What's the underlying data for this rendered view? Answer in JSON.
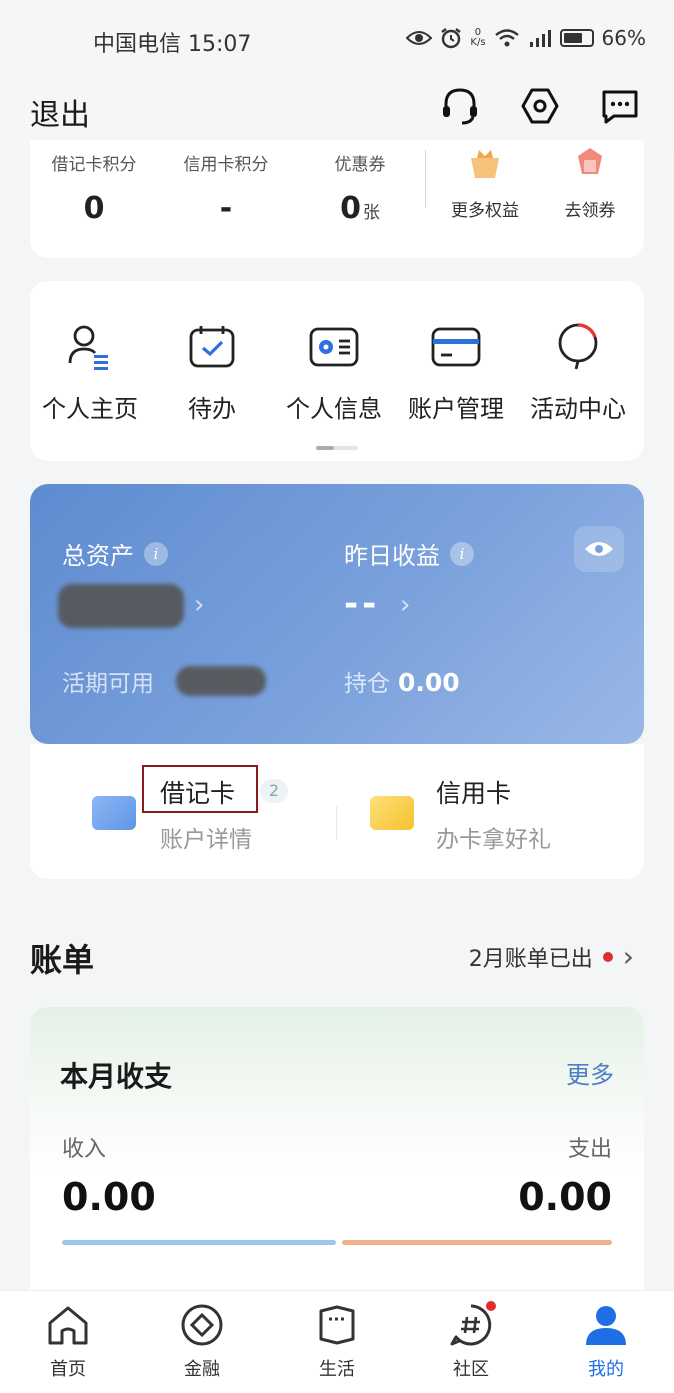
{
  "status_bar": {
    "carrier_time": "中国电信 15:07",
    "net_speed": "0",
    "net_unit": "K/s",
    "battery": "66%",
    "icons": [
      "eye-icon",
      "alarm-icon",
      "wifi-icon",
      "signal-icon",
      "battery-icon"
    ]
  },
  "header": {
    "exit_label": "退出",
    "icons": [
      "headset-icon",
      "settings-icon",
      "message-icon"
    ]
  },
  "points": {
    "debit_points_label": "借记卡积分",
    "debit_points_value": "0",
    "credit_points_label": "信用卡积分",
    "credit_points_value": "-",
    "coupon_label": "优惠券",
    "coupon_value": "0",
    "coupon_unit": "张",
    "more_benefits": "更多权益",
    "get_coupons": "去领券"
  },
  "quick_menu": {
    "items": [
      {
        "label": "个人主页",
        "icon": "profile-icon"
      },
      {
        "label": "待办",
        "icon": "calendar-icon"
      },
      {
        "label": "个人信息",
        "icon": "id-card-icon"
      },
      {
        "label": "账户管理",
        "icon": "bank-card-icon"
      },
      {
        "label": "活动中心",
        "icon": "balloon-icon"
      }
    ]
  },
  "assets": {
    "total_label": "总资产",
    "yesterday_label": "昨日收益",
    "yesterday_value": "--",
    "available_label": "活期可用",
    "holding_label": "持仓",
    "holding_value": "0.00"
  },
  "cards": {
    "debit_title": "借记卡",
    "debit_count": "2",
    "debit_sub": "账户详情",
    "credit_title": "信用卡",
    "credit_sub": "办卡拿好礼"
  },
  "bill": {
    "title": "账单",
    "status": "2月账单已出",
    "monthly_title": "本月收支",
    "more": "更多",
    "income_label": "收入",
    "income_value": "0.00",
    "expense_label": "支出",
    "expense_value": "0.00"
  },
  "tabbar": {
    "items": [
      {
        "label": "首页",
        "icon": "home-icon"
      },
      {
        "label": "金融",
        "icon": "finance-icon"
      },
      {
        "label": "生活",
        "icon": "ticket-icon"
      },
      {
        "label": "社区",
        "icon": "hashtag-icon"
      },
      {
        "label": "我的",
        "icon": "user-icon"
      }
    ],
    "active": "我的",
    "colors": {
      "active": "#1e6fe6",
      "inactive": "#333333"
    }
  },
  "colors": {
    "accent_blue": "#4d7fc4",
    "assets_gradient_start": "#5e8bd0",
    "notification_red": "#e32d2d"
  }
}
